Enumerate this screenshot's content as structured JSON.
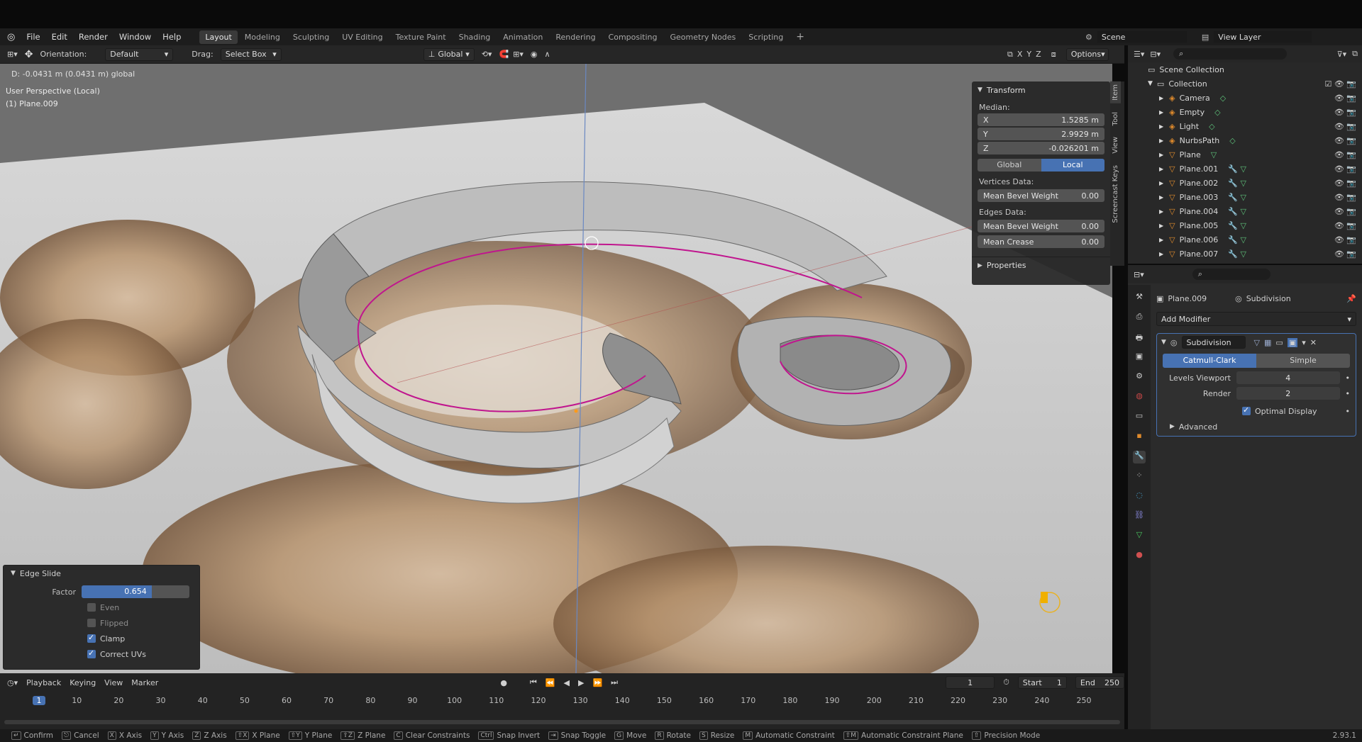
{
  "menu": {
    "items": [
      "File",
      "Edit",
      "Render",
      "Window",
      "Help"
    ]
  },
  "workspaces": [
    "Layout",
    "Modeling",
    "Sculpting",
    "UV Editing",
    "Texture Paint",
    "Shading",
    "Animation",
    "Rendering",
    "Compositing",
    "Geometry Nodes",
    "Scripting"
  ],
  "active_workspace": "Layout",
  "scene": {
    "name": "Scene",
    "view_layer": "View Layer"
  },
  "header": {
    "orientation_label": "Orientation:",
    "orientation_value": "Default",
    "drag_label": "Drag:",
    "drag_value": "Select Box",
    "transform_orientation": "Global",
    "axes": [
      "X",
      "Y",
      "Z"
    ],
    "options": "Options"
  },
  "viewport": {
    "info_line": "D: -0.0431 m (0.0431 m) global",
    "view_name": "User Perspective (Local)",
    "object_name": "(1) Plane.009"
  },
  "npanel": {
    "transform_title": "Transform",
    "median_label": "Median:",
    "x": {
      "label": "X",
      "value": "1.5285 m"
    },
    "y": {
      "label": "Y",
      "value": "2.9929 m"
    },
    "z": {
      "label": "Z",
      "value": "-0.026201 m"
    },
    "global_btn": "Global",
    "local_btn": "Local",
    "vertices_data": "Vertices Data:",
    "v_bevel": {
      "label": "Mean Bevel Weight",
      "value": "0.00"
    },
    "edges_data": "Edges Data:",
    "e_bevel": {
      "label": "Mean Bevel Weight",
      "value": "0.00"
    },
    "e_crease": {
      "label": "Mean Crease",
      "value": "0.00"
    },
    "properties_title": "Properties",
    "tabs": [
      "Item",
      "Tool",
      "View",
      "Screencast Keys"
    ]
  },
  "outliner": {
    "root": "Scene Collection",
    "collection": "Collection",
    "items": [
      "Camera",
      "Empty",
      "Light",
      "NurbsPath",
      "Plane",
      "Plane.001",
      "Plane.002",
      "Plane.003",
      "Plane.004",
      "Plane.005",
      "Plane.006",
      "Plane.007"
    ]
  },
  "properties": {
    "object": "Plane.009",
    "modifier_name": "Subdivision",
    "add_modifier": "Add Modifier",
    "mod_title": "Subdivision",
    "catmull": "Catmull-Clark",
    "simple": "Simple",
    "levels_viewport": {
      "label": "Levels Viewport",
      "value": "4"
    },
    "render": {
      "label": "Render",
      "value": "2"
    },
    "optimal_display": "Optimal Display",
    "advanced": "Advanced"
  },
  "redo": {
    "title": "Edge Slide",
    "factor_label": "Factor",
    "factor_value": "0.654",
    "factor_fraction": 0.654,
    "even": "Even",
    "flipped": "Flipped",
    "clamp": "Clamp",
    "correct_uvs": "Correct UVs"
  },
  "timeline": {
    "menus": [
      "Playback",
      "Keying",
      "View",
      "Marker"
    ],
    "current_frame": "1",
    "start_label": "Start",
    "start": "1",
    "end_label": "End",
    "end": "250",
    "ticks": [
      "1",
      "10",
      "20",
      "30",
      "40",
      "50",
      "60",
      "70",
      "80",
      "90",
      "100",
      "110",
      "120",
      "130",
      "140",
      "150",
      "160",
      "170",
      "180",
      "190",
      "200",
      "210",
      "220",
      "230",
      "240",
      "250"
    ]
  },
  "statusbar": {
    "items": [
      {
        "key": "↵",
        "label": "Confirm"
      },
      {
        "key": "⎋",
        "label": "Cancel"
      },
      {
        "key": "X",
        "label": "X Axis"
      },
      {
        "key": "Y",
        "label": "Y Axis"
      },
      {
        "key": "Z",
        "label": "Z Axis"
      },
      {
        "key": "⇧X",
        "label": "X Plane"
      },
      {
        "key": "⇧Y",
        "label": "Y Plane"
      },
      {
        "key": "⇧Z",
        "label": "Z Plane"
      },
      {
        "key": "C",
        "label": "Clear Constraints"
      },
      {
        "key": "Ctrl",
        "label": "Snap Invert"
      },
      {
        "key": "⇥",
        "label": "Snap Toggle"
      },
      {
        "key": "G",
        "label": "Move"
      },
      {
        "key": "R",
        "label": "Rotate"
      },
      {
        "key": "S",
        "label": "Resize"
      },
      {
        "key": "M",
        "label": "Automatic Constraint"
      },
      {
        "key": "⇧M",
        "label": "Automatic Constraint Plane"
      },
      {
        "key": "⇧",
        "label": "Precision Mode"
      }
    ],
    "version": "2.93.1"
  }
}
